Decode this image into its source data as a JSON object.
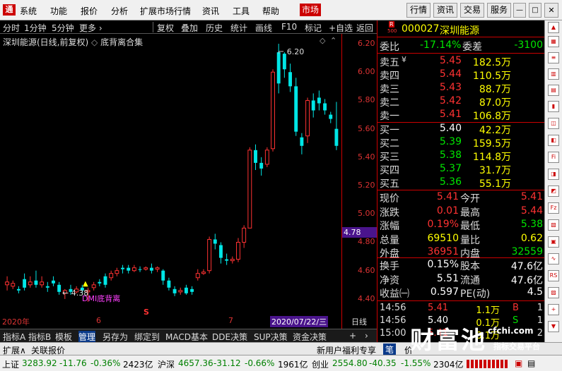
{
  "menu": {
    "logo": "通",
    "items": [
      "系统",
      "功能",
      "报价",
      "分析",
      "扩展市场行情",
      "资讯",
      "工具",
      "帮助",
      "市场"
    ],
    "right": [
      "行情",
      "资讯",
      "交易",
      "服务"
    ]
  },
  "toolbar": {
    "items": [
      "分时",
      "1分钟",
      "5分钟",
      "更多 ›",
      "复权",
      "叠加",
      "历史",
      "统计",
      "画线",
      "F10",
      "标记",
      "+自选",
      "返回"
    ]
  },
  "chart": {
    "title": "深圳能源(日线,前复权)",
    "indicator": "底背离合集",
    "ylabels": [
      "6.20",
      "6.00",
      "5.80",
      "5.60",
      "5.40",
      "5.20",
      "5.00",
      "4.80",
      "4.60",
      "4.40"
    ],
    "cursor_price": "4.78",
    "hi_label": "6.20",
    "lo_label": "4.38",
    "signal_label": "DMI底背离",
    "s_mark": "S",
    "x_year": "2020年",
    "x_m1": "6",
    "x_m2": "7",
    "x_date": "2020/07/22/三",
    "x_period": "日线"
  },
  "chart_data": {
    "type": "candlestick",
    "title": "深圳能源(日线,前复权)",
    "ylim": [
      4.3,
      6.25
    ],
    "candles": [
      [
        4.52,
        4.5,
        4.56,
        4.46,
        "u"
      ],
      [
        4.49,
        4.51,
        4.53,
        4.47,
        "u"
      ],
      [
        4.47,
        4.46,
        4.49,
        4.44,
        "d"
      ],
      [
        4.54,
        4.48,
        4.58,
        4.46,
        "d"
      ],
      [
        4.5,
        4.52,
        4.56,
        4.48,
        "u"
      ],
      [
        4.53,
        4.5,
        4.6,
        4.48,
        "d"
      ],
      [
        4.5,
        4.52,
        4.56,
        4.48,
        "u"
      ],
      [
        4.49,
        4.48,
        4.52,
        4.45,
        "d"
      ],
      [
        4.53,
        4.51,
        4.56,
        4.49,
        "d"
      ],
      [
        4.5,
        4.45,
        4.52,
        4.43,
        "d"
      ],
      [
        4.44,
        4.46,
        4.47,
        4.4,
        "u"
      ],
      [
        4.47,
        4.45,
        4.5,
        4.43,
        "d"
      ],
      [
        4.45,
        4.47,
        4.49,
        4.44,
        "u"
      ],
      [
        4.48,
        4.46,
        4.5,
        4.44,
        "d"
      ],
      [
        4.45,
        4.46,
        4.48,
        4.38,
        "u"
      ],
      [
        4.48,
        4.5,
        4.52,
        4.46,
        "u"
      ],
      [
        4.52,
        4.51,
        4.54,
        4.49,
        "d"
      ],
      [
        4.56,
        4.5,
        4.58,
        4.48,
        "d"
      ],
      [
        4.55,
        4.58,
        4.6,
        4.53,
        "u"
      ],
      [
        4.58,
        4.6,
        4.62,
        4.56,
        "u"
      ],
      [
        4.62,
        4.61,
        4.64,
        4.58,
        "d"
      ],
      [
        4.62,
        4.6,
        4.64,
        4.58,
        "d"
      ],
      [
        4.6,
        4.62,
        4.64,
        4.59,
        "u"
      ],
      [
        4.61,
        4.61,
        4.63,
        4.59,
        "d"
      ],
      [
        4.61,
        4.62,
        4.63,
        4.6,
        "u"
      ],
      [
        4.62,
        4.6,
        4.65,
        4.58,
        "d"
      ],
      [
        4.61,
        4.62,
        4.63,
        4.59,
        "u"
      ],
      [
        4.6,
        4.53,
        4.61,
        4.5,
        "d"
      ],
      [
        4.53,
        4.48,
        4.55,
        4.46,
        "d"
      ],
      [
        4.47,
        4.44,
        4.49,
        4.42,
        "d"
      ],
      [
        4.45,
        4.46,
        4.48,
        4.43,
        "u"
      ],
      [
        4.48,
        4.44,
        4.5,
        4.43,
        "d"
      ],
      [
        4.47,
        4.45,
        4.49,
        4.43,
        "d"
      ],
      [
        4.55,
        4.58,
        4.61,
        4.53,
        "u"
      ],
      [
        4.58,
        4.59,
        4.61,
        4.57,
        "u"
      ],
      [
        4.6,
        4.82,
        4.84,
        4.58,
        "u"
      ],
      [
        4.82,
        4.79,
        4.86,
        4.75,
        "d"
      ],
      [
        4.78,
        4.69,
        4.8,
        4.65,
        "d"
      ],
      [
        4.68,
        4.67,
        4.72,
        4.64,
        "d"
      ],
      [
        4.67,
        4.68,
        4.7,
        4.65,
        "u"
      ],
      [
        4.68,
        4.8,
        4.83,
        4.66,
        "u"
      ],
      [
        4.8,
        4.9,
        4.92,
        4.76,
        "u"
      ],
      [
        4.9,
        5.45,
        5.47,
        4.9,
        "u"
      ],
      [
        5.45,
        5.36,
        5.49,
        5.31,
        "d"
      ],
      [
        5.36,
        5.32,
        5.4,
        5.27,
        "d"
      ],
      [
        5.35,
        5.45,
        5.47,
        5.33,
        "u"
      ],
      [
        5.46,
        6.0,
        6.02,
        5.44,
        "u"
      ],
      [
        5.92,
        6.14,
        6.2,
        5.85,
        "d"
      ],
      [
        6.13,
        6.02,
        6.14,
        5.96,
        "d"
      ],
      [
        6.0,
        5.9,
        6.06,
        5.86,
        "d"
      ],
      [
        5.9,
        5.58,
        5.96,
        5.55,
        "d"
      ],
      [
        5.54,
        5.48,
        5.57,
        5.42,
        "d"
      ],
      [
        5.55,
        5.8,
        5.82,
        5.5,
        "u"
      ],
      [
        5.8,
        5.73,
        5.85,
        5.68,
        "d"
      ],
      [
        5.82,
        5.78,
        5.87,
        5.73,
        "d"
      ],
      [
        5.78,
        5.73,
        5.81,
        5.7,
        "d"
      ],
      [
        5.7,
        5.67,
        5.72,
        5.64,
        "d"
      ],
      [
        5.6,
        5.48,
        5.79,
        5.45,
        "d"
      ]
    ]
  },
  "tabs": [
    "指标A",
    "指标B",
    "模板",
    "管理",
    "另存为",
    "绑定到",
    "MACD基本",
    "DDE决策",
    "SUP决策",
    "资金决策",
    "+",
    "›"
  ],
  "bottom_tabs": [
    "扩展∧",
    "关联报价",
    "新用户福利专享",
    "笔",
    "价"
  ],
  "quote": {
    "code_badge": "R",
    "code_sub": "500",
    "code": "000027",
    "name": "深圳能源",
    "wb_label": "委比",
    "wb_value": "-17.14%",
    "wc_label": "委差",
    "wc_value": "-3100",
    "asks": [
      {
        "label": "卖五",
        "extra": "¥",
        "price": "5.45",
        "vol": "182.5万"
      },
      {
        "label": "卖四",
        "price": "5.44",
        "vol": "110.5万"
      },
      {
        "label": "卖三",
        "price": "5.43",
        "vol": "88.7万"
      },
      {
        "label": "卖二",
        "price": "5.42",
        "vol": "87.0万"
      },
      {
        "label": "卖一",
        "price": "5.41",
        "vol": "106.8万"
      }
    ],
    "bids": [
      {
        "label": "买一",
        "price": "5.40",
        "vol": "42.2万"
      },
      {
        "label": "买二",
        "price": "5.39",
        "vol": "159.5万"
      },
      {
        "label": "买三",
        "price": "5.38",
        "vol": "114.8万"
      },
      {
        "label": "买四",
        "price": "5.37",
        "vol": "31.7万"
      },
      {
        "label": "买五",
        "price": "5.36",
        "vol": "55.1万"
      }
    ],
    "stats": [
      [
        "现价",
        "5.41",
        "今开",
        "5.41"
      ],
      [
        "涨跌",
        "0.01",
        "最高",
        "5.44"
      ],
      [
        "涨幅",
        "0.19%",
        "最低",
        "5.38"
      ],
      [
        "总量",
        "69510",
        "量比",
        "0.62"
      ],
      [
        "外盘",
        "36951",
        "内盘",
        "32559"
      ]
    ],
    "stats2": [
      [
        "换手",
        "0.15%",
        "股本",
        "47.6亿"
      ],
      [
        "净资",
        "5.51",
        "流通",
        "47.6亿"
      ],
      [
        "收益㈠",
        "0.597",
        "PE(动)",
        "4.5"
      ]
    ],
    "ticks": [
      {
        "time": "14:56",
        "price": "5.41",
        "vol": "1.1万",
        "bs": "B",
        "n": "1"
      },
      {
        "time": "14:56",
        "price": "5.40",
        "vol": "0.1万",
        "bs": "S",
        "n": "1"
      },
      {
        "time": "15:00",
        "price": "5.41",
        "vol": "8.1万",
        "bs": "",
        "n": "2"
      }
    ]
  },
  "status": {
    "sh_label": "上证",
    "sh": "3283.92",
    "sh_chg": "-11.76",
    "sh_pct": "-0.36%",
    "sh_amt": "2423亿",
    "hs_label": "沪深",
    "hs": "4657.36",
    "hs_chg": "-31.12",
    "hs_pct": "-0.66%",
    "hs_amt": "1961亿",
    "cy_label": "创业",
    "cy": "2554.80",
    "cy_chg": "-40.35",
    "cy_pct": "-1.55%",
    "cy_amt": "2304亿"
  },
  "watermark": {
    "big": "财富池",
    "url": "cfchi.com",
    "sub": "指标交易平台"
  },
  "colors": {
    "up": "#ff3232",
    "down": "#00e6e6",
    "grid": "#c00000"
  }
}
